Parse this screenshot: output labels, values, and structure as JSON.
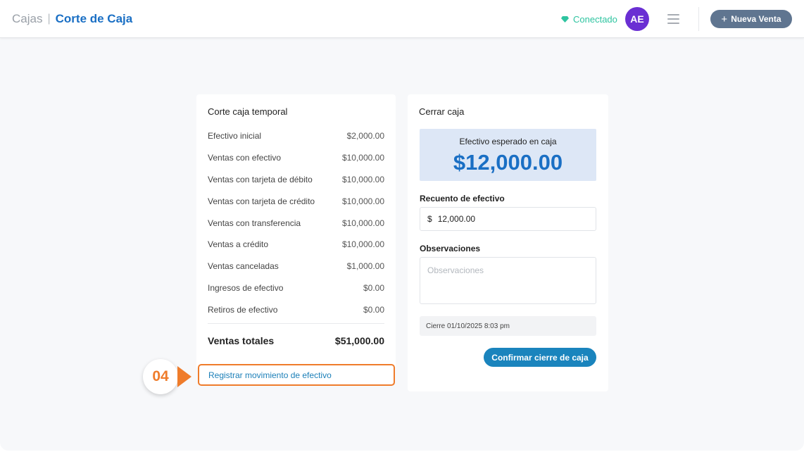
{
  "header": {
    "breadcrumb_root": "Cajas",
    "breadcrumb_separator": "|",
    "breadcrumb_current": "Corte de Caja",
    "status_label": "Conectado",
    "avatar_initials": "AE",
    "new_sale_label": "Nueva Venta",
    "new_sale_icon": "+"
  },
  "summary": {
    "title": "Corte caja temporal",
    "rows": [
      {
        "label": "Efectivo inicial",
        "value": "$2,000.00"
      },
      {
        "label": "Ventas con efectivo",
        "value": "$10,000.00"
      },
      {
        "label": "Ventas con tarjeta de débito",
        "value": "$10,000.00"
      },
      {
        "label": "Ventas con tarjeta de crédito",
        "value": "$10,000.00"
      },
      {
        "label": "Ventas con transferencia",
        "value": "$10,000.00"
      },
      {
        "label": "Ventas a crédito",
        "value": "$10,000.00"
      },
      {
        "label": "Ventas canceladas",
        "value": "$1,000.00"
      },
      {
        "label": "Ingresos de efectivo",
        "value": "$0.00"
      },
      {
        "label": "Retiros de efectivo",
        "value": "$0.00"
      }
    ],
    "total_label": "Ventas totales",
    "total_value": "$51,000.00",
    "register_link": "Registrar movimiento de efectivo"
  },
  "annotation": {
    "step_number": "04",
    "accent_color": "#ef7c2b"
  },
  "close": {
    "title": "Cerrar caja",
    "expected_label": "Efectivo esperado en caja",
    "expected_amount": "$12,000.00",
    "count_label": "Recuento de efectivo",
    "count_currency": "$",
    "count_value": "12,000.00",
    "observations_label": "Observaciones",
    "observations_placeholder": "Observaciones",
    "closing_stamp": "Cierre 01/10/2025 8:03 pm",
    "confirm_label": "Confirmar cierre de caja"
  },
  "colors": {
    "brand_blue": "#1a6fc4",
    "status_green": "#2ec4a0",
    "avatar_purple": "#6a2fd3",
    "button_slate": "#5f7590",
    "confirm_blue": "#1a84bd"
  },
  "icons": {
    "status": "diamond-gem-icon",
    "menu": "hamburger-menu-icon"
  }
}
